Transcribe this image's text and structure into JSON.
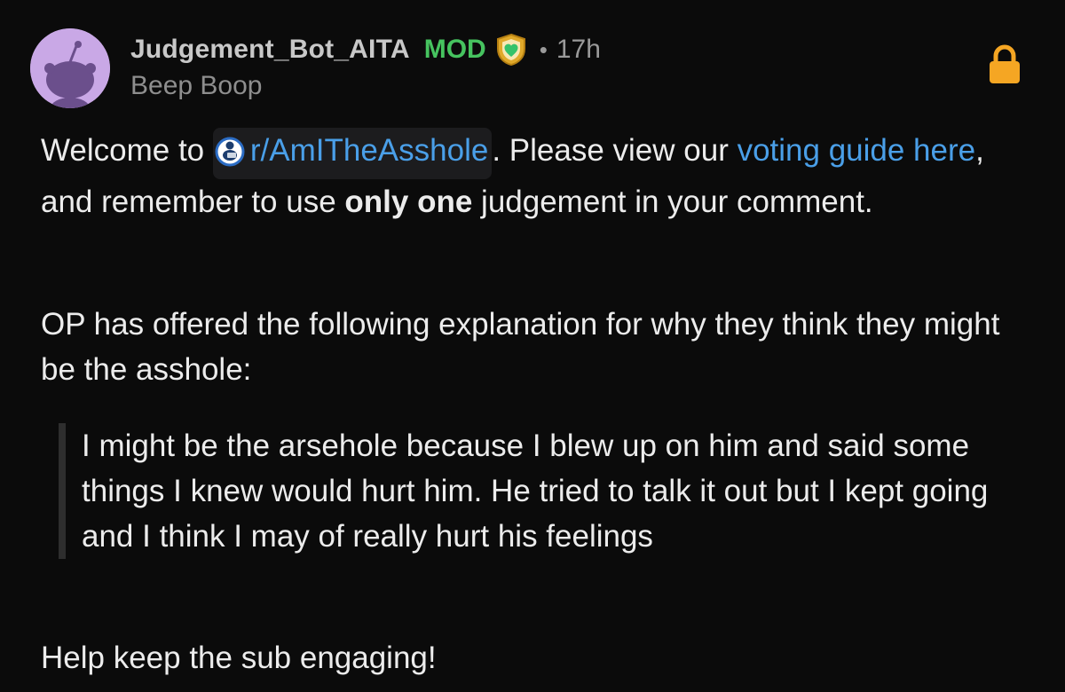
{
  "comment": {
    "username": "Judgement_Bot_AITA",
    "mod_label": "MOD",
    "time_separator": "•",
    "time": "17h",
    "flair": "Beep Boop",
    "icons": {
      "avatar": "snoo-avatar",
      "mod_shield": "shield-heart-icon",
      "lock": "lock-icon",
      "subreddit": "subreddit-snoo-icon"
    },
    "colors": {
      "background": "#0b0b0b",
      "mod": "#46c35f",
      "link": "#4a9fe8",
      "lock": "#f5a623",
      "avatar": "#c9a8e6"
    },
    "body": {
      "p1": {
        "welcome": "Welcome to",
        "subreddit": "r/AmITheAsshole",
        "after_sub": ". Please view our ",
        "guide_link": "voting guide here",
        "after_guide": ", and remember to use ",
        "bold": "only one",
        "end": " judgement in your comment."
      },
      "p2": "OP has offered the following explanation for why they think they might be the asshole:",
      "quote": "I might be the arsehole because I blew up on him and said some things I knew would hurt him. He tried to talk it out but I kept going and I think I may of really hurt his feelings",
      "p3": "Help keep the sub engaging!"
    }
  }
}
